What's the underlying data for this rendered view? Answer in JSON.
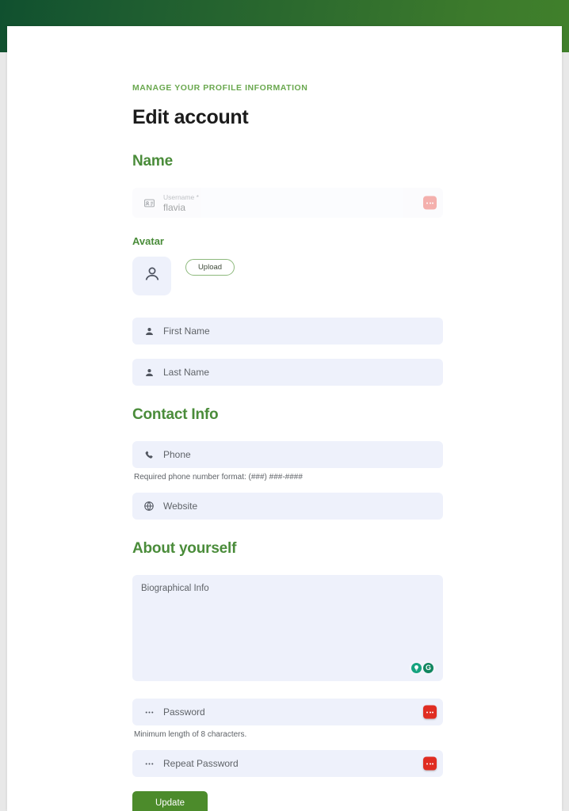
{
  "theme": {
    "banner_gradient_start": "#10502f",
    "banner_gradient_end": "#40802b",
    "heading_green": "#4a8c3a",
    "eyebrow_green": "#6aa84f",
    "button_green": "#4c8b2b",
    "input_background": "#eef1fb",
    "password_manager_red": "#e02d22",
    "grammarly_green": "#15a37f"
  },
  "header": {
    "eyebrow": "MANAGE YOUR PROFILE INFORMATION",
    "title": "Edit account"
  },
  "sections": {
    "name": {
      "heading": "Name",
      "username_field": {
        "label": "Username *",
        "value": "flavia",
        "icon": "id-card-icon",
        "badge_icon": "password-manager-icon",
        "disabled": true
      },
      "avatar": {
        "label": "Avatar",
        "icon": "person-icon",
        "upload_label": "Upload"
      },
      "first_name": {
        "placeholder": "First Name",
        "value": "",
        "icon": "person-icon"
      },
      "last_name": {
        "placeholder": "Last Name",
        "value": "",
        "icon": "person-icon"
      }
    },
    "contact": {
      "heading": "Contact Info",
      "phone": {
        "placeholder": "Phone",
        "value": "",
        "icon": "phone-icon",
        "helper": "Required phone number format: (###) ###-####"
      },
      "website": {
        "placeholder": "Website",
        "value": "",
        "icon": "globe-icon"
      }
    },
    "about": {
      "heading": "About yourself",
      "bio": {
        "placeholder": "Biographical Info",
        "value": "",
        "assistant_icons": [
          "lightbulb-icon",
          "grammarly-g-icon"
        ],
        "assistant_g_label": "G"
      }
    },
    "security": {
      "password": {
        "placeholder": "Password",
        "value": "",
        "icon": "dots-icon",
        "badge_icon": "password-manager-icon",
        "helper": "Minimum length of 8 characters."
      },
      "repeat_password": {
        "placeholder": "Repeat Password",
        "value": "",
        "icon": "dots-icon",
        "badge_icon": "password-manager-icon"
      }
    }
  },
  "footer": {
    "submit_label": "Update"
  }
}
